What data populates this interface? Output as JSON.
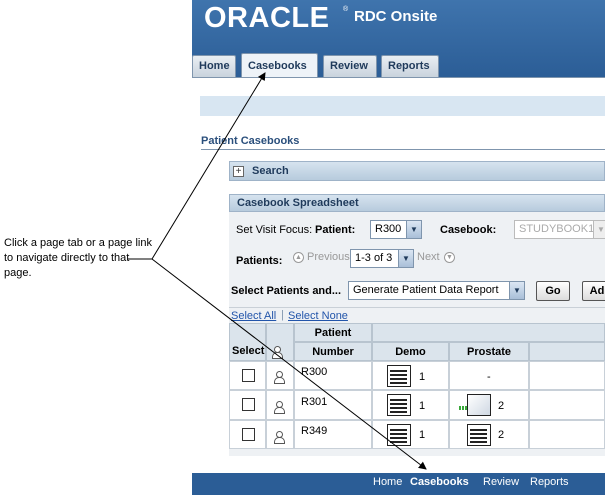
{
  "header": {
    "logo_text": "ORACLE",
    "logo_mark": "®",
    "app_name": "RDC Onsite"
  },
  "tabs": [
    {
      "label": "Home",
      "active": false
    },
    {
      "label": "Casebooks",
      "active": true
    },
    {
      "label": "Review",
      "active": false
    },
    {
      "label": "Reports",
      "active": false
    }
  ],
  "page": {
    "title": "Patient Casebooks"
  },
  "search": {
    "toggle": "+",
    "label": "Search"
  },
  "spreadsheet": {
    "title": "Casebook Spreadsheet",
    "visit_focus_label": "Set Visit Focus:",
    "patient_label": "Patient:",
    "patient_value": "R300",
    "casebook_label": "Casebook:",
    "casebook_value": "STUDYBOOK1",
    "patients_label": "Patients:",
    "previous_label": "Previous",
    "range_value": "1-3 of 3",
    "next_label": "Next",
    "select_patients_label": "Select Patients and...",
    "action_value": "Generate Patient Data Report",
    "go_label": "Go",
    "add_label": "Ad",
    "select_all": "Select All",
    "select_none": "Select None",
    "columns": {
      "select": "Select",
      "patient_top": "Patient",
      "patient_bottom": "Number",
      "demo": "Demo",
      "prostate": "Prostate"
    },
    "rows": [
      {
        "number": "R300",
        "demo_count": "1",
        "prostate": "-"
      },
      {
        "number": "R301",
        "demo_count": "1",
        "prostate": "2"
      },
      {
        "number": "R349",
        "demo_count": "1",
        "prostate": "2"
      }
    ]
  },
  "footer": {
    "links": [
      {
        "label": "Home",
        "active": false
      },
      {
        "label": "Casebooks",
        "active": true
      },
      {
        "label": "Review",
        "active": false
      },
      {
        "label": "Reports",
        "active": false
      }
    ]
  },
  "annotation": {
    "text": "Click a page tab or a page link to navigate directly to that page."
  },
  "colors": {
    "header_blue": "#2b5d96",
    "panel_header": "#b7cbdd",
    "link_blue": "#2255aa",
    "status_green": "#39a83a"
  }
}
